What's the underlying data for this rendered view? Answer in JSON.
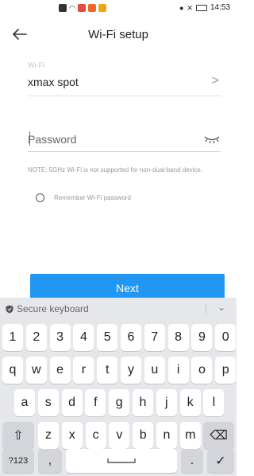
{
  "status_bar": {
    "time": "14:53",
    "left_icons": [
      "app-icon",
      "wifi-icon",
      "notification-icon",
      "notification-icon",
      "notification-icon"
    ],
    "right_icons": [
      "location-icon",
      "mute-icon",
      "battery-icon"
    ]
  },
  "header": {
    "title": "Wi-Fi setup",
    "back_icon": "back-arrow-icon"
  },
  "wifi": {
    "label": "Wi-Fi",
    "value": "xmax spot",
    "chevron": ">"
  },
  "password": {
    "placeholder": "Password",
    "value": "",
    "toggle_icon": "eye-closed-icon"
  },
  "note": "NOTE: 5GHz Wi-Fi is not supported for non-dual-band device.",
  "remember": {
    "label": "Remember Wi-Fi password",
    "checked": false
  },
  "next_button": {
    "label": "Next",
    "color": "#2196f3"
  },
  "keyboard": {
    "header": "Secure keyboard",
    "collapse": "⌄",
    "row1": [
      "1",
      "2",
      "3",
      "4",
      "5",
      "6",
      "7",
      "8",
      "9",
      "0"
    ],
    "row2": [
      "q",
      "w",
      "e",
      "r",
      "t",
      "y",
      "u",
      "i",
      "o",
      "p"
    ],
    "row3": [
      "a",
      "s",
      "d",
      "f",
      "g",
      "h",
      "j",
      "k",
      "l"
    ],
    "row4": [
      "z",
      "x",
      "c",
      "v",
      "b",
      "n",
      "m"
    ],
    "shift": "⇧",
    "backspace": "⌫",
    "mode": "?123",
    "comma": ",",
    "period": ".",
    "done": "✓"
  }
}
